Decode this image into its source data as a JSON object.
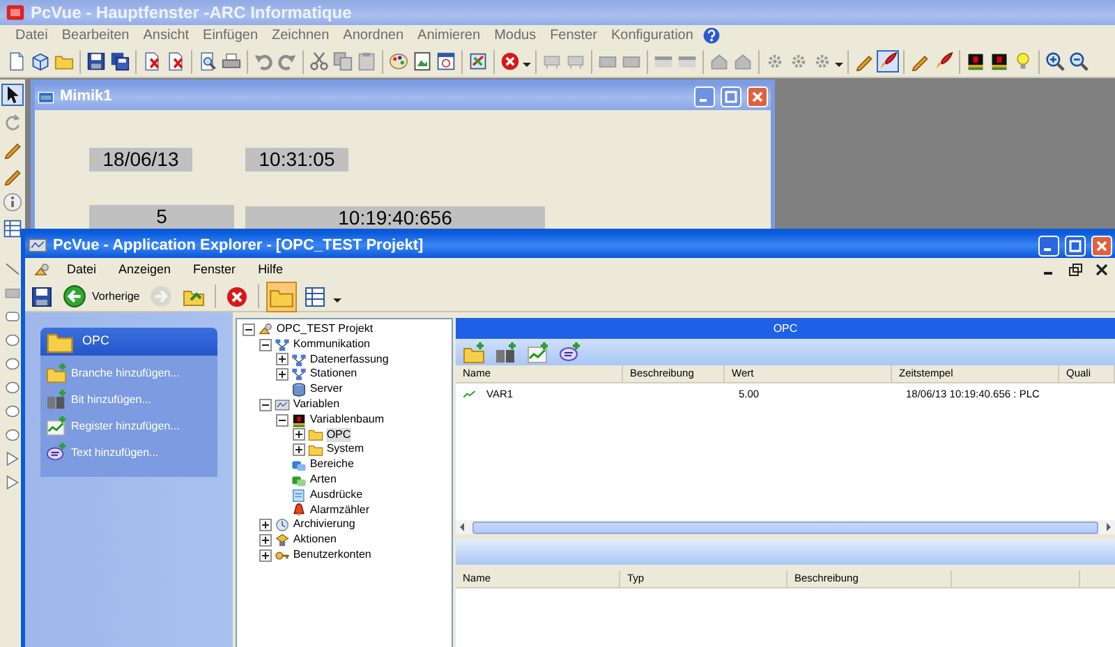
{
  "main_window": {
    "title": "PcVue - Hauptfenster -ARC Informatique",
    "menu": [
      "Datei",
      "Bearbeiten",
      "Ansicht",
      "Einfügen",
      "Zeichnen",
      "Anordnen",
      "Animieren",
      "Modus",
      "Fenster",
      "Konfiguration"
    ],
    "mode_button_pressed": true,
    "pointer_tool_selected": true
  },
  "mimic_window": {
    "title": "Mimik1",
    "displays": [
      {
        "text": "18/06/13"
      },
      {
        "text": "10:31:05"
      },
      {
        "text": "5"
      },
      {
        "text": "10:19:40:656"
      }
    ]
  },
  "explorer": {
    "title": "PcVue - Application Explorer - [OPC_TEST Projekt]",
    "menu": [
      "Datei",
      "Anzeigen",
      "Fenster",
      "Hilfe"
    ],
    "toolbar": {
      "back_label": "Vorherige",
      "forward_disabled": true,
      "folders_button_pressed": true
    },
    "task_pane": {
      "title": "OPC",
      "tasks": [
        "Branche hinzufügen...",
        "Bit hinzufügen...",
        "Register hinzufügen...",
        "Text hinzufügen..."
      ]
    },
    "tree": [
      {
        "label": "OPC_TEST Projekt",
        "expanded": true,
        "selected": false,
        "children": [
          {
            "label": "Kommunikation",
            "expanded": true,
            "selected": false,
            "children": [
              {
                "label": "Datenerfassung",
                "expanded": false,
                "selected": false
              },
              {
                "label": "Stationen",
                "expanded": false,
                "selected": false
              },
              {
                "label": "Server",
                "selected": false
              }
            ]
          },
          {
            "label": "Variablen",
            "expanded": true,
            "selected": false,
            "children": [
              {
                "label": "Variablenbaum",
                "expanded": true,
                "selected": false,
                "children": [
                  {
                    "label": "OPC",
                    "expanded": false,
                    "selected": true
                  },
                  {
                    "label": "System",
                    "expanded": false,
                    "selected": false
                  }
                ]
              },
              {
                "label": "Bereiche",
                "selected": false
              },
              {
                "label": "Arten",
                "selected": false
              },
              {
                "label": "Ausdrücke",
                "selected": false
              },
              {
                "label": "Alarmzähler",
                "selected": false
              }
            ]
          },
          {
            "label": "Archivierung",
            "expanded": false,
            "selected": false
          },
          {
            "label": "Aktionen",
            "expanded": false,
            "selected": false
          },
          {
            "label": "Benutzerkonten",
            "expanded": false,
            "selected": false
          }
        ]
      }
    ],
    "detail": {
      "title": "OPC",
      "columns": [
        "Name",
        "Beschreibung",
        "Wert",
        "Zeitstempel",
        "Quali"
      ],
      "rows": [
        [
          "VAR1",
          "",
          "5.00",
          "18/06/13 10:19:40.656 : PLC"
        ]
      ]
    },
    "lower_table": {
      "columns": [
        "Name",
        "Typ",
        "Beschreibung"
      ]
    }
  }
}
